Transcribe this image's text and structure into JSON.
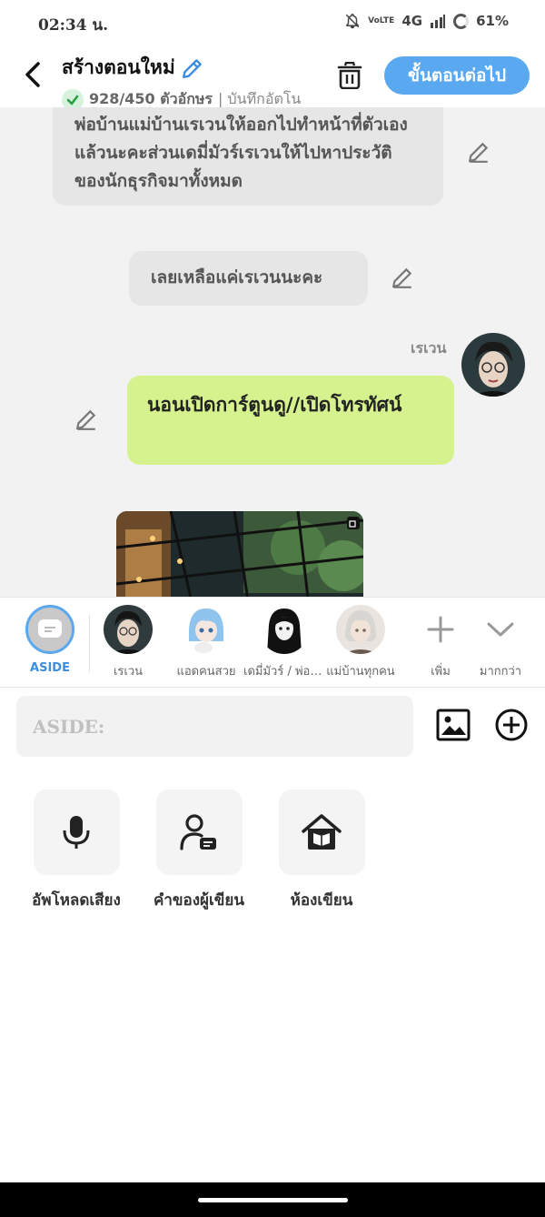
{
  "status_bar": {
    "time": "02:34 น.",
    "volte": "VoLTE",
    "network": "4G",
    "battery": "61%"
  },
  "header": {
    "title": "สร้างตอนใหม่",
    "char_count": "928/450 ตัวอักษร",
    "save_status": "| บันทึกอัตโน",
    "next_button": "ขั้นตอนต่อไป"
  },
  "chat": {
    "messages": [
      {
        "type": "narration",
        "text": "พ่อบ้านแม่บ้านเรเวนให้ออกไปทำหน้าที่ตัวเองแล้วนะคะส่วนเดมี่มัวร์เรเวนให้ไปหาประวัติของนักธุรกิจมาทั้งหมด"
      },
      {
        "type": "narration",
        "text": "เลยเหลือแค่เรเวนนะคะ"
      },
      {
        "type": "character",
        "speaker": "เรเวน",
        "text": "นอนเปิดการ์ตูนดู//เปิดโทรทัศน์"
      }
    ]
  },
  "characters": [
    {
      "label": "ASIDE",
      "icon": "aside-chat-icon"
    },
    {
      "label": "เรเวน",
      "icon": "avatar"
    },
    {
      "label": "แอดคนสวย",
      "icon": "avatar"
    },
    {
      "label": "เดมี่มัวร์ / พ่อบ้าน",
      "icon": "avatar"
    },
    {
      "label": "แม่บ้านทุกคน",
      "icon": "avatar"
    }
  ],
  "actions": {
    "add_label": "เพิ่ม",
    "more_label": "มากกว่า"
  },
  "input": {
    "placeholder": "ASIDE:"
  },
  "tools": [
    {
      "label": "อัพโหลดเสียง",
      "icon": "microphone-icon"
    },
    {
      "label": "คำของผู้เขียน",
      "icon": "author-note-icon"
    },
    {
      "label": "ห้องเขียน",
      "icon": "writing-room-icon"
    }
  ],
  "colors": {
    "accent": "#5aa8ef",
    "character_bubble": "#d6f28e",
    "narration_bubble": "#e6e6e6",
    "chat_background": "#f2f2f2"
  }
}
